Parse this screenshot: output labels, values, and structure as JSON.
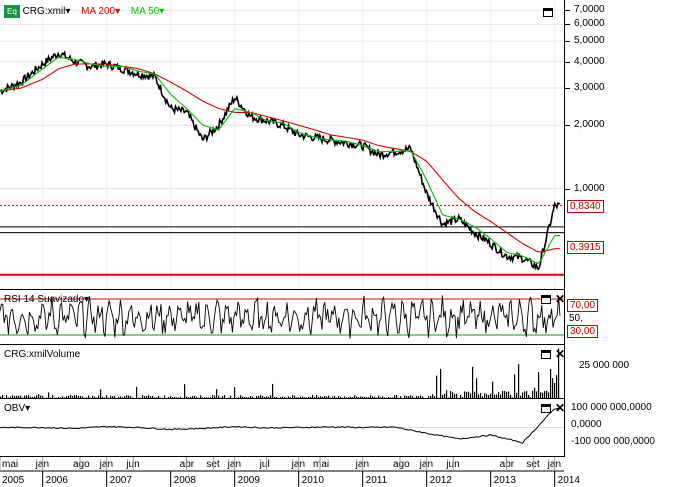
{
  "header": {
    "symbol_badge": "Eq",
    "symbol": "CRG:xmil",
    "ma_slow": "MA 200",
    "ma_fast": "MA 50"
  },
  "colors": {
    "price": "#000000",
    "ma_slow": "#e00000",
    "ma_fast": "#00c000",
    "level_line": "#e00000",
    "rsi_upper": "#e00000",
    "rsi_lower": "#00a000",
    "grid": "#c8c8c8"
  },
  "price_axis": {
    "ticks": [
      "7,0000",
      "6,0000",
      "5,0000",
      "4,0000",
      "3,0000",
      "2,0000",
      "1,0000"
    ],
    "tick_values": [
      7,
      6,
      5,
      4,
      3,
      2,
      1
    ],
    "last_label": "0,8340",
    "level_label": "0,3915"
  },
  "rsi": {
    "title": "RSI 14 Suavizado",
    "upper_label": "70,00",
    "mid_label": "50,",
    "lower_label": "30,00"
  },
  "volume": {
    "title": "CRG:xmilVolume",
    "tick_label": "25 000 000"
  },
  "obv": {
    "title": "OBV",
    "ticks": [
      "100 000 000,0000",
      "0,0000",
      "-100 000 000,0000"
    ]
  },
  "time_axis": {
    "month_labels": [
      {
        "text": "mai"
      },
      {
        "text": "jan"
      },
      {
        "text": "ago"
      },
      {
        "text": "jan"
      },
      {
        "text": "jun"
      },
      {
        "text": "abr"
      },
      {
        "text": "set"
      },
      {
        "text": "jan"
      },
      {
        "text": "jul"
      },
      {
        "text": "jan"
      },
      {
        "text": "mai"
      },
      {
        "text": "jan"
      },
      {
        "text": "ago"
      },
      {
        "text": "jan"
      },
      {
        "text": "jun"
      },
      {
        "text": "abr"
      },
      {
        "text": "set"
      },
      {
        "text": "jan"
      }
    ],
    "year_labels": [
      "2005",
      "2006",
      "2007",
      "2008",
      "2009",
      "2010",
      "2011",
      "2012",
      "2013",
      "2014"
    ]
  },
  "chart_data": [
    {
      "type": "line",
      "ylim": [
        0.35,
        7.5
      ],
      "log_scale": true,
      "x": [
        "2005-05",
        "2005-09",
        "2006-01",
        "2006-04",
        "2006-07",
        "2006-10",
        "2007-01",
        "2007-04",
        "2007-07",
        "2007-10",
        "2008-01",
        "2008-04",
        "2008-07",
        "2008-10",
        "2009-01",
        "2009-04",
        "2009-07",
        "2009-10",
        "2010-01",
        "2010-04",
        "2010-07",
        "2010-10",
        "2011-01",
        "2011-04",
        "2011-07",
        "2011-10",
        "2012-01",
        "2012-04",
        "2012-07",
        "2012-10",
        "2013-01",
        "2013-04",
        "2013-07",
        "2013-10",
        "2014-01"
      ],
      "series": [
        {
          "name": "CRG:xmil",
          "values": [
            2.9,
            3.2,
            3.9,
            4.4,
            4.0,
            3.8,
            3.9,
            3.7,
            3.5,
            3.4,
            2.4,
            2.3,
            1.7,
            2.0,
            2.7,
            2.2,
            2.1,
            2.0,
            1.8,
            1.75,
            1.7,
            1.65,
            1.6,
            1.45,
            1.5,
            1.55,
            0.95,
            0.68,
            0.72,
            0.62,
            0.55,
            0.48,
            0.47,
            0.42,
            0.83
          ]
        },
        {
          "name": "MA 200",
          "values": [
            2.9,
            3.0,
            3.3,
            3.7,
            3.9,
            3.9,
            3.9,
            3.8,
            3.7,
            3.5,
            3.2,
            2.9,
            2.6,
            2.4,
            2.3,
            2.3,
            2.2,
            2.1,
            2.0,
            1.9,
            1.8,
            1.75,
            1.7,
            1.6,
            1.55,
            1.5,
            1.35,
            1.1,
            0.9,
            0.78,
            0.7,
            0.62,
            0.55,
            0.5,
            0.52
          ]
        },
        {
          "name": "MA 50",
          "values": [
            2.9,
            3.1,
            3.7,
            4.2,
            4.1,
            3.9,
            3.8,
            3.8,
            3.6,
            3.5,
            2.8,
            2.4,
            2.0,
            1.9,
            2.4,
            2.3,
            2.1,
            2.05,
            1.85,
            1.75,
            1.7,
            1.68,
            1.6,
            1.5,
            1.5,
            1.52,
            1.1,
            0.75,
            0.72,
            0.66,
            0.58,
            0.5,
            0.48,
            0.44,
            0.6
          ]
        }
      ],
      "hlines": [
        0.3915,
        0.62,
        0.66
      ]
    },
    {
      "type": "line",
      "ylim": [
        20,
        80
      ],
      "hlines": [
        70,
        50,
        30
      ]
    },
    {
      "type": "bar",
      "ylim": [
        0,
        35000000
      ]
    },
    {
      "type": "line",
      "ylim": [
        -150000000,
        150000000
      ],
      "x": [
        "2005-05",
        "2006-01",
        "2006-07",
        "2007-01",
        "2007-07",
        "2008-01",
        "2008-07",
        "2009-01",
        "2009-07",
        "2010-01",
        "2010-07",
        "2011-01",
        "2011-07",
        "2012-01",
        "2012-07",
        "2013-01",
        "2013-07",
        "2014-01"
      ],
      "values": [
        0,
        0,
        -5000000,
        5000000,
        0,
        -10000000,
        -5000000,
        5000000,
        -2000000,
        0,
        3000000,
        0,
        2000000,
        -30000000,
        -60000000,
        -40000000,
        -80000000,
        100000000
      ]
    }
  ]
}
